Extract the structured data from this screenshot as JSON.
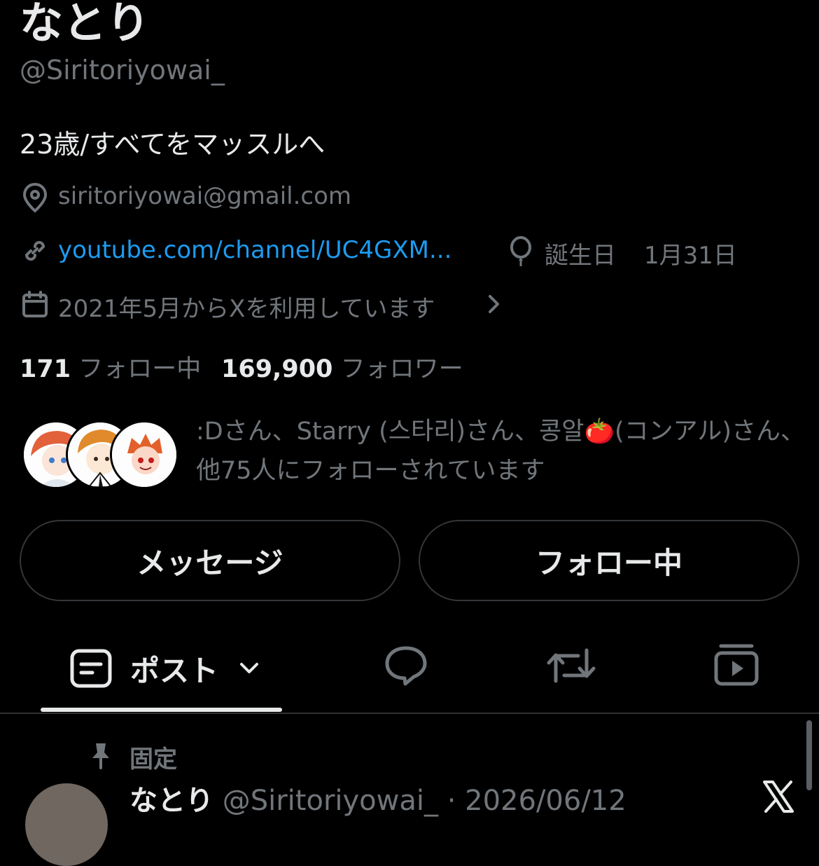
{
  "profile": {
    "name": "なとり",
    "handle": "@Siritoriyowai_",
    "bio": "23歳/すべてをマッスルへ",
    "location": "siritoriyowai@gmail.com",
    "website": "youtube.com/channel/UC4GXM...",
    "birthday_label": "誕生日",
    "birthday_value": "1月31日",
    "joined": "2021年5月からXを利用しています"
  },
  "stats": {
    "following_count": "171",
    "following_label": "フォロー中",
    "followers_count": "169,900",
    "followers_label": "フォロワー"
  },
  "followed_by": {
    "text": ":Dさん、Starry (스타리)さん、콩알🍅(コンアル)さん、他75人にフォローされています"
  },
  "buttons": {
    "message": "メッセージ",
    "following": "フォロー中"
  },
  "tabs": {
    "posts": "ポスト"
  },
  "pinned": {
    "label": "固定",
    "author_name": "なとり",
    "author_handle": "@Siritoriyowai_",
    "separator": "·",
    "date": "2026/06/12"
  },
  "colors": {
    "background": "#000000",
    "text": "#e7e9ea",
    "muted": "#71767b",
    "link": "#1d9bf0",
    "border": "#333639"
  },
  "icons": {
    "location": "location-pin-icon",
    "link": "link-icon",
    "birthday": "balloon-icon",
    "calendar": "calendar-icon",
    "chevron": "chevron-right-icon",
    "posts_tab": "posts-tab-icon",
    "replies_tab": "reply-bubble-icon",
    "reposts_tab": "repost-icon",
    "media_tab": "media-play-icon",
    "pin": "pin-icon",
    "x_logo": "x-logo-icon"
  }
}
